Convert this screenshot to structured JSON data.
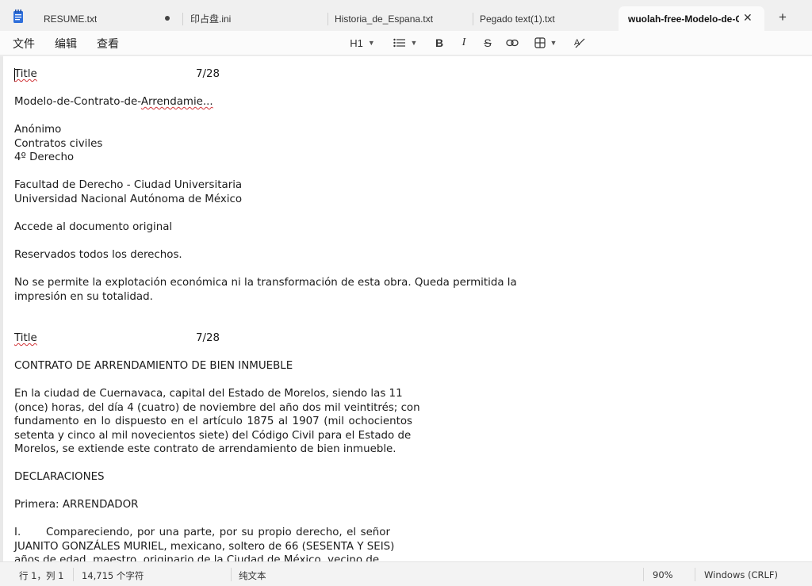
{
  "tabs": [
    {
      "label": "RESUME.txt",
      "unsaved": true
    },
    {
      "label": "印占盘.ini"
    },
    {
      "label": "Historia_de_Espana.txt"
    },
    {
      "label": "Pegado text(1).txt"
    },
    {
      "label": "wuolah-free-Modelo-de-C",
      "active": true
    }
  ],
  "new_tab_label": "+",
  "menu": {
    "file": "文件",
    "edit": "编辑",
    "view": "查看"
  },
  "toolbar": {
    "heading": "H1",
    "bold": "B",
    "italic": "I",
    "strike": "S"
  },
  "document": {
    "title_1": "Title",
    "page_1": "7/28",
    "l1": "Modelo-de-Contrato-de-",
    "l1b": "Arrendamie...",
    "l2": "Anónimo",
    "l3": "Contratos civiles",
    "l4": "4º Derecho",
    "l5": "Facultad de Derecho - Ciudad Universitaria",
    "l6": "Universidad Nacional Autónoma de México",
    "l7": "Accede al documento original",
    "l8": "Reservados todos los derechos.",
    "l9": "No se permite la explotación económica ni la transformación de esta obra. Queda permitida la",
    "l10": "impresión en su totalidad.",
    "title_2": "Title",
    "page_2": "7/28",
    "l11": "CONTRATO DE ARRENDAMIENTO DE BIEN INMUEBLE",
    "l12": "En la ciudad de Cuernavaca, capital del Estado de Morelos, siendo las 11",
    "l13": "(once) horas, del día 4 (cuatro) de noviembre del año dos mil veintitrés; con",
    "l14": "fundamento en lo dispuesto en el artículo 1875 al 1907 (mil ochocientos",
    "l15": "setenta y cinco al mil novecientos siete) del Código Civil para el Estado de",
    "l16": "Morelos, se extiende este contrato de arrendamiento de bien inmueble.",
    "l17": "DECLARACIONES",
    "l18": "Primera: ARRENDADOR",
    "l19a": "I.",
    "l19b": "Compareciendo, por una parte, por su propio derecho, el señor",
    "l20": "JUANITO GONZÁLES MURIEL, mexicano, soltero de 66 (SESENTA Y SEIS)",
    "l21": "años de edad, maestro, originario de la Ciudad de México, vecino de"
  },
  "status": {
    "position": "行 1，列 1",
    "chars": "14,715 个字符",
    "format": "纯文本",
    "zoom": "90%",
    "eol": "Windows (CRLF)"
  },
  "colors": {
    "spellcheck": "#d13438",
    "app_icon": "#2f6fdb"
  }
}
